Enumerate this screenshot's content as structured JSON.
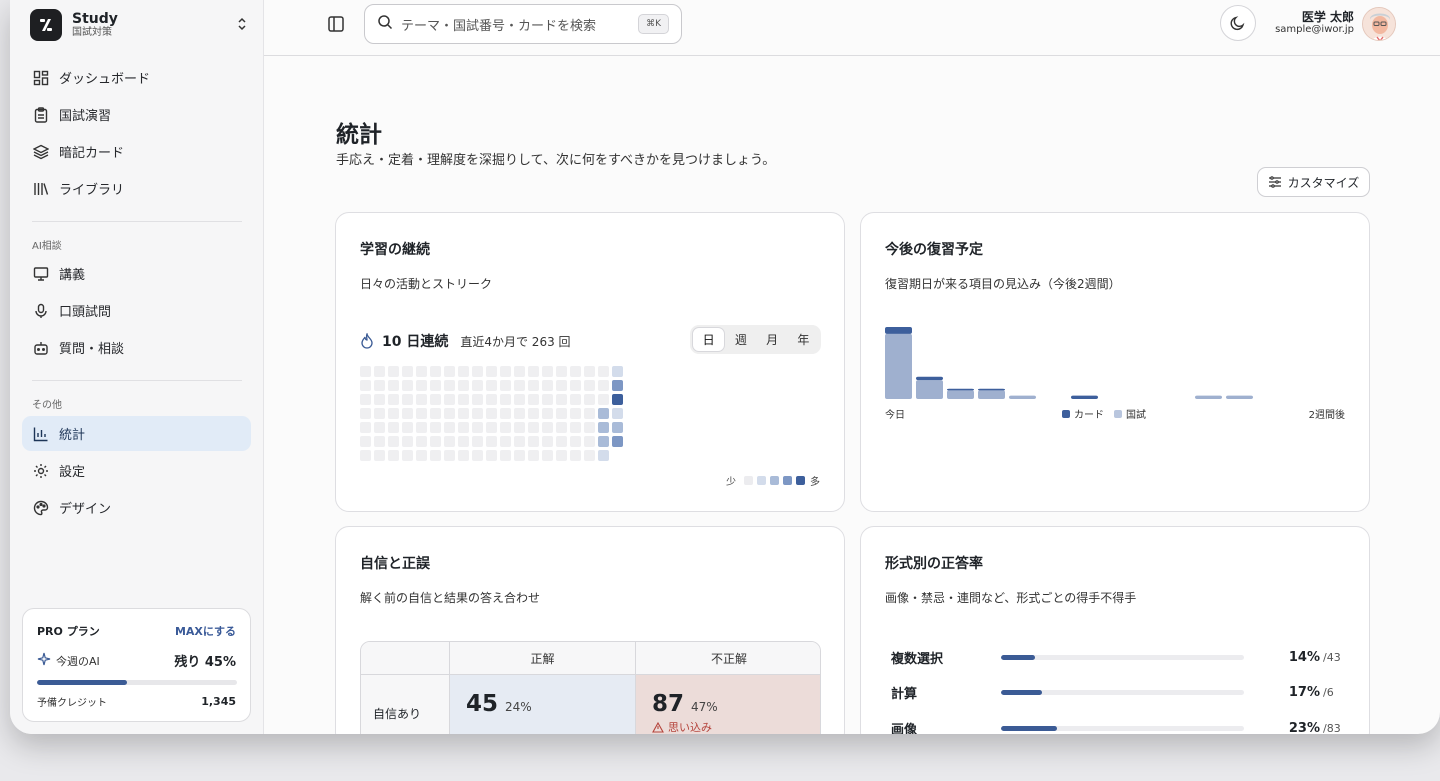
{
  "brand": {
    "title": "Study",
    "subtitle": "国試対策"
  },
  "nav": {
    "main": [
      {
        "label": "ダッシュボード",
        "icon": "dashboard-icon"
      },
      {
        "label": "国試演習",
        "icon": "clipboard-icon"
      },
      {
        "label": "暗記カード",
        "icon": "layers-icon"
      },
      {
        "label": "ライブラリ",
        "icon": "library-icon"
      }
    ],
    "ai_section_label": "AI相談",
    "ai": [
      {
        "label": "講義",
        "icon": "presentation-icon"
      },
      {
        "label": "口頭試問",
        "icon": "microphone-icon"
      },
      {
        "label": "質問・相談",
        "icon": "bot-icon"
      }
    ],
    "other_section_label": "その他",
    "other": [
      {
        "label": "統計",
        "icon": "bar-chart-icon",
        "active": true
      },
      {
        "label": "設定",
        "icon": "gear-icon"
      },
      {
        "label": "デザイン",
        "icon": "palette-icon"
      }
    ]
  },
  "plan": {
    "name": "PRO プラン",
    "upgrade": "MAXにする",
    "ai_label": "今週のAI",
    "remaining": "残り 45%",
    "remaining_fraction": 0.45,
    "credit_label": "予備クレジット",
    "credit": "1,345"
  },
  "header": {
    "search_placeholder": "テーマ・国試番号・カードを検索",
    "shortcut": "⌘K",
    "user_name": "医学 太郎",
    "user_email": "sample@iwor.jp"
  },
  "page": {
    "title": "統計",
    "subtitle": "手応え・定着・理解度を深掘りして、次に何をすべきかを見つけましょう。",
    "customize": "カスタマイズ"
  },
  "streak_card": {
    "title": "学習の継続",
    "subtitle": "日々の活動とストリーク",
    "streak": "10 日連続",
    "total": "直近4か月で 263 回",
    "tabs": [
      "日",
      "週",
      "月",
      "年"
    ],
    "active_tab": 0,
    "legend_low": "少",
    "legend_high": "多",
    "levels": [
      "#ececef",
      "#d3dceb",
      "#a9bbd8",
      "#7d97c4",
      "#3d5f9c"
    ],
    "heatmap_last_column": [
      1,
      3,
      4,
      1,
      2,
      3,
      2
    ],
    "heatmap_second_last_column": [
      0,
      0,
      0,
      2,
      2,
      2,
      1
    ]
  },
  "forecast_card": {
    "title": "今後の復習予定",
    "subtitle": "復習期日が来る項目の見込み（今後2週間）",
    "start_label": "今日",
    "end_label": "2週間後",
    "legend": [
      {
        "label": "カード",
        "color": "#3d5f9c"
      },
      {
        "label": "国試",
        "color": "#b9c6de"
      }
    ],
    "chart_data": {
      "type": "bar",
      "categories": [
        "1",
        "2",
        "3",
        "4",
        "5",
        "6",
        "7",
        "8",
        "9",
        "10",
        "11",
        "12"
      ],
      "series": [
        {
          "name": "カード",
          "values": [
            4,
            2,
            1,
            1,
            0,
            0,
            2,
            0,
            0,
            0,
            0,
            0
          ]
        },
        {
          "name": "国試",
          "values": [
            38,
            11,
            5,
            5,
            2,
            0,
            0,
            0,
            0,
            0,
            2,
            2
          ]
        }
      ]
    }
  },
  "confidence_card": {
    "title": "自信と正誤",
    "subtitle": "解く前の自信と結果の答え合わせ",
    "col_correct": "正解",
    "col_incorrect": "不正解",
    "row_confident": "自信あり",
    "correct_count": "45",
    "correct_pct": "24%",
    "incorrect_count": "87",
    "incorrect_pct": "47%",
    "warning": "思い込み"
  },
  "format_card": {
    "title": "形式別の正答率",
    "subtitle": "画像・禁忌・連問など、形式ごとの得手不得手",
    "rows": [
      {
        "label": "複数選択",
        "pct": "14%",
        "total": "/43",
        "value": 0.14
      },
      {
        "label": "計算",
        "pct": "17%",
        "total": "/6",
        "value": 0.17
      },
      {
        "label": "画像",
        "pct": "23%",
        "total": "/83",
        "value": 0.23
      }
    ]
  }
}
